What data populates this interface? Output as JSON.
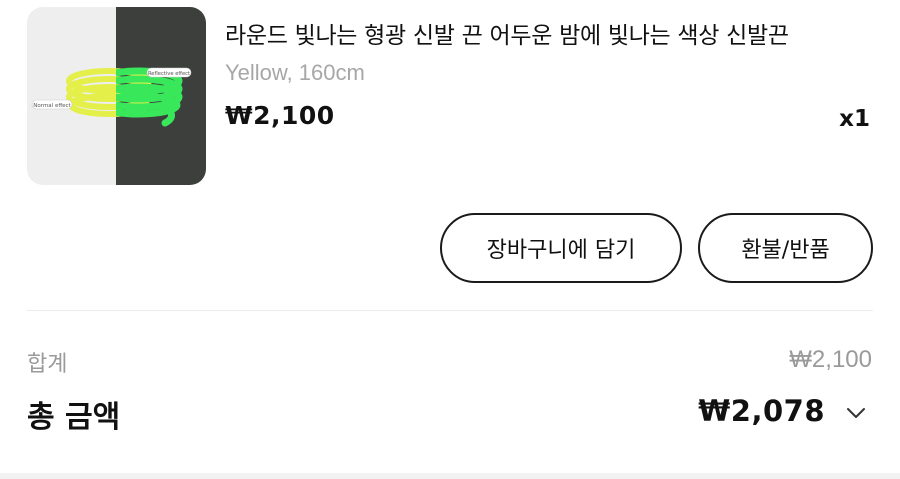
{
  "product": {
    "title": "라운드 빛나는 형광 신발 끈 어두운 밤에 빛나는 색상 신발끈",
    "variant": "Yellow, 160cm",
    "price": "₩2,100",
    "quantity": "x1",
    "image": {
      "label_normal": "Normal effect",
      "label_reflective": "Reflective effect"
    }
  },
  "actions": {
    "add_to_cart_label": "장바구니에 담기",
    "refund_label": "환불/반품"
  },
  "summary": {
    "subtotal_label": "합계",
    "subtotal_value": "₩2,100",
    "total_label": "총 금액",
    "total_value": "₩2,078"
  },
  "icons": {
    "expand": "chevron-down-icon"
  },
  "colors": {
    "shoelace_normal": "#e4ef4a",
    "shoelace_glow": "#39e85a",
    "image_dark_bg": "#3d3f3d",
    "muted_text": "#9a9a9a"
  }
}
